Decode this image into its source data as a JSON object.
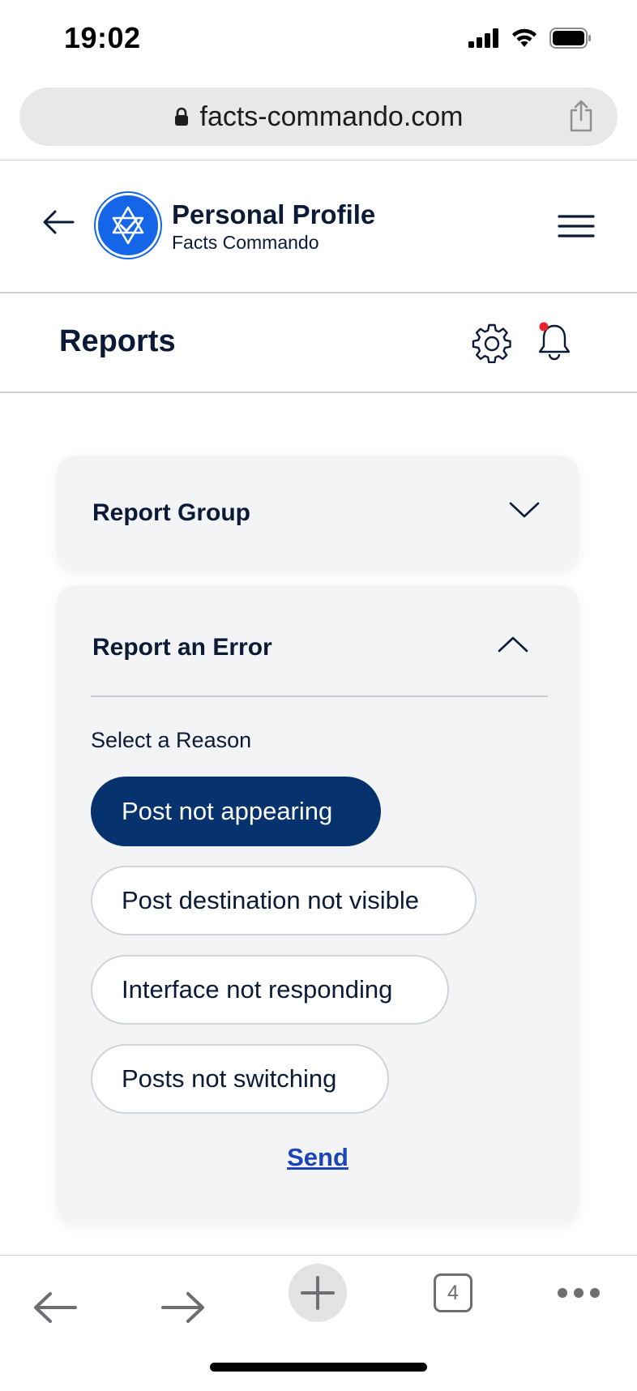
{
  "status_bar": {
    "time": "19:02"
  },
  "browser": {
    "url": "facts-commando.com",
    "tab_count": "4"
  },
  "site_header": {
    "title": "Personal Profile",
    "subtitle": "Facts Commando"
  },
  "page": {
    "title": "Reports"
  },
  "accordion": {
    "report_group": {
      "title": "Report Group",
      "expanded": false
    },
    "report_error": {
      "title": "Report an Error",
      "expanded": true,
      "reason_label": "Select a Reason",
      "reasons": [
        {
          "label": "Post not appearing",
          "selected": true
        },
        {
          "label": "Post destination not visible",
          "selected": false
        },
        {
          "label": "Interface not responding",
          "selected": false
        },
        {
          "label": "Posts not switching",
          "selected": false
        }
      ],
      "send_label": "Send"
    }
  },
  "colors": {
    "brand_blue": "#1565e8",
    "selected_pill": "#06326e",
    "link": "#1d45b8",
    "notification_dot": "#e8232a",
    "text_dark": "#0b1a36"
  },
  "icons": {
    "status": [
      "signal-icon",
      "wifi-icon",
      "battery-icon"
    ],
    "url_bar": [
      "lock-icon",
      "share-icon"
    ],
    "header": [
      "back-arrow-icon",
      "star-check-logo-icon",
      "hamburger-menu-icon"
    ],
    "title_row": [
      "gear-icon",
      "bell-icon"
    ],
    "toolbar": [
      "arrow-left-icon",
      "arrow-right-icon",
      "plus-icon",
      "tabs-icon",
      "more-icon"
    ]
  }
}
